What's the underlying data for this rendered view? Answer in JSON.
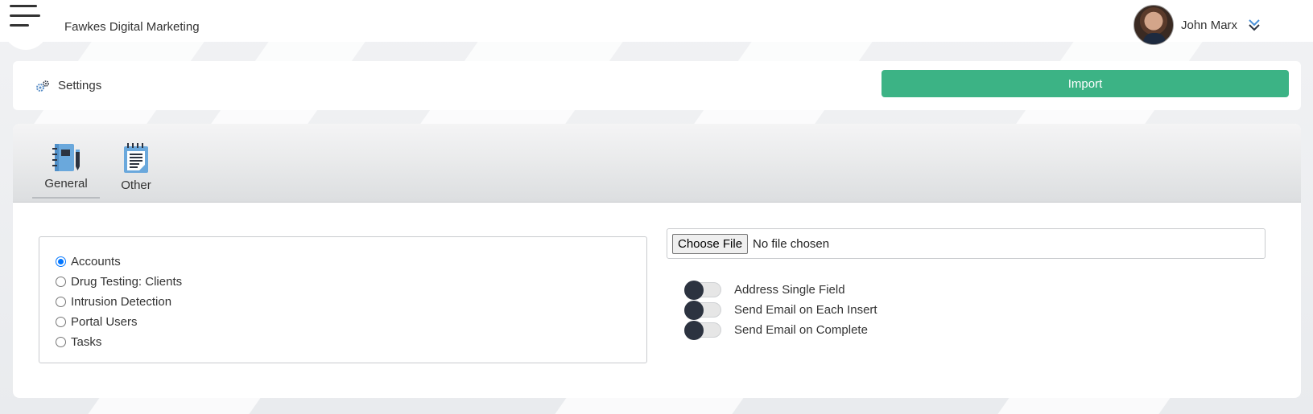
{
  "header": {
    "company": "Fawkes Digital Marketing",
    "user_name": "John Marx"
  },
  "toolbar": {
    "settings_label": "Settings",
    "import_label": "Import"
  },
  "tabs": [
    {
      "label": "General",
      "icon": "notebook-pen-icon",
      "active": true
    },
    {
      "label": "Other",
      "icon": "notepad-icon",
      "active": false
    }
  ],
  "import_types": [
    {
      "label": "Accounts",
      "checked": true
    },
    {
      "label": "Drug Testing: Clients",
      "checked": false
    },
    {
      "label": "Intrusion Detection",
      "checked": false
    },
    {
      "label": "Portal Users",
      "checked": false
    },
    {
      "label": "Tasks",
      "checked": false
    }
  ],
  "file_input": {
    "button_label": "Choose File",
    "status": "No file chosen"
  },
  "options": [
    {
      "label": "Address Single Field",
      "on": false
    },
    {
      "label": "Send Email on Each Insert",
      "on": false
    },
    {
      "label": "Send Email on Complete",
      "on": false
    }
  ],
  "colors": {
    "accent_green": "#3cb385",
    "icon_blue": "#6aa8dc",
    "toggle_knob": "#2c3340"
  }
}
